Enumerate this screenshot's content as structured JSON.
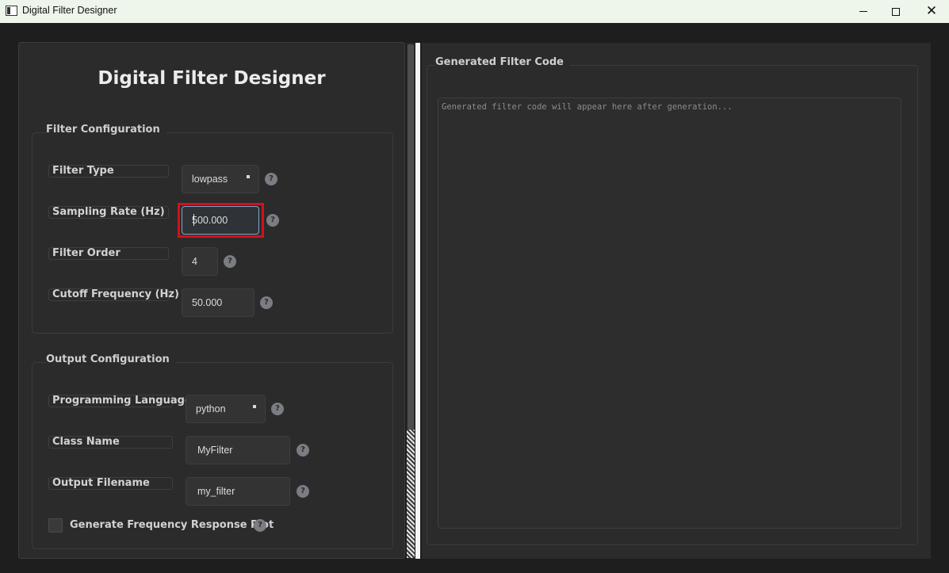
{
  "window": {
    "title": "Digital Filter Designer",
    "minimize": "minimize-icon",
    "maximize": "maximize-icon",
    "close": "✕"
  },
  "app_title": "Digital Filter Designer",
  "filter_config": {
    "title": "Filter Configuration",
    "filter_type": {
      "label": "Filter Type",
      "value": "lowpass"
    },
    "sampling_rate": {
      "label": "Sampling Rate (Hz)",
      "value": "500.000"
    },
    "filter_order": {
      "label": "Filter Order",
      "value": "4"
    },
    "cutoff": {
      "label": "Cutoff Frequency (Hz)",
      "value": "50.000"
    }
  },
  "output_config": {
    "title": "Output Configuration",
    "language": {
      "label": "Programming Language",
      "value": "python"
    },
    "class_name": {
      "label": "Class Name",
      "value": "MyFilter"
    },
    "filename": {
      "label": "Output Filename",
      "value": "my_filter"
    },
    "plot": {
      "label": "Generate Frequency Response Plot",
      "checked": false
    }
  },
  "help_glyph": "?",
  "code_panel": {
    "title": "Generated Filter Code",
    "placeholder": "Generated filter code will appear here after generation..."
  }
}
